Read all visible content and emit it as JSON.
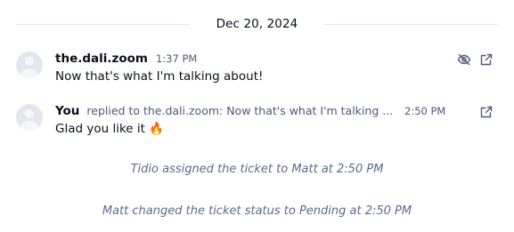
{
  "date_divider": "Dec 20, 2024",
  "messages": [
    {
      "author": "the.dali.zoom",
      "time": "1:37 PM",
      "text": "Now that's what I'm talking about!",
      "actions": [
        "eye-off-icon",
        "open-external-icon"
      ]
    },
    {
      "author": "You",
      "reply_context": "replied to the.dali.zoom: Now that's what I'm talking ...",
      "time": "2:50 PM",
      "text": "Glad you like it 🔥",
      "actions": [
        "open-external-icon"
      ]
    }
  ],
  "system_events": [
    "Tidio assigned the ticket to Matt at 2:50 PM",
    "Matt changed the ticket status to Pending at 2:50 PM"
  ],
  "colors": {
    "text_primary": "#080f1a",
    "text_secondary": "#4c5a71",
    "system_text": "#5b6b86",
    "divider": "#e2e8ef",
    "avatar": "#e3e7ed"
  }
}
